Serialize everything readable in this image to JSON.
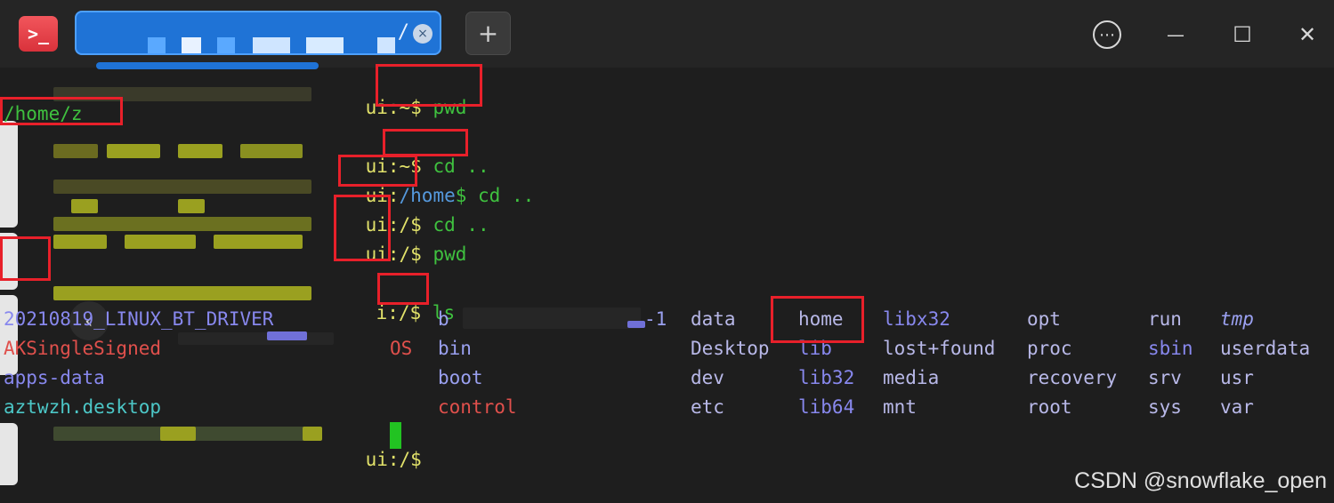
{
  "window": {
    "app_icon_glyph": ">_",
    "tab_title": "/",
    "tab_close_glyph": "×",
    "new_tab_glyph": "+",
    "menu_glyph": "⋯",
    "minimize_glyph": "—",
    "maximize_glyph": "☐",
    "close_glyph": "✕",
    "accent_color": "#1f73d6"
  },
  "terminal": {
    "lines": [
      {
        "prompt": "ui:~$",
        "command": " pwd"
      },
      {
        "output": "/home/z"
      },
      {
        "prompt": "ui:~$",
        "command": " cd .."
      },
      {
        "prompt_user": "ui:",
        "cwd": "/home",
        "rest": "$ cd .."
      },
      {
        "prompt": "ui:/$",
        "command": " cd .."
      },
      {
        "prompt": "ui:/$",
        "command": " pwd"
      },
      {
        "prompt": "i:/$",
        "command": " ls"
      },
      {
        "prompt": "ui:/$",
        "command": ""
      }
    ],
    "ls": {
      "col1": [
        "20210819_LINUX_BT_DRIVER",
        "AKSingleSigned",
        "apps-data",
        "aztwzh.desktop"
      ],
      "col2": [
        "b",
        "bin",
        "boot",
        "control"
      ],
      "col2_suffix": "-1",
      "col1_suffix": "OS",
      "col3": [
        "data",
        "Desktop",
        "dev",
        "etc"
      ],
      "col4": [
        "home",
        "lib",
        "lib32",
        "lib64"
      ],
      "col5": [
        "libx32",
        "lost+found",
        "media",
        "mnt"
      ],
      "col6": [
        "opt",
        "proc",
        "recovery",
        "root"
      ],
      "col7": [
        "run",
        "sbin",
        "srv",
        "sys"
      ],
      "col8": [
        "tmp",
        "userdata",
        "usr",
        "var"
      ]
    }
  },
  "nav_back_glyph": "‹",
  "watermark": "CSDN @snowflake_open"
}
